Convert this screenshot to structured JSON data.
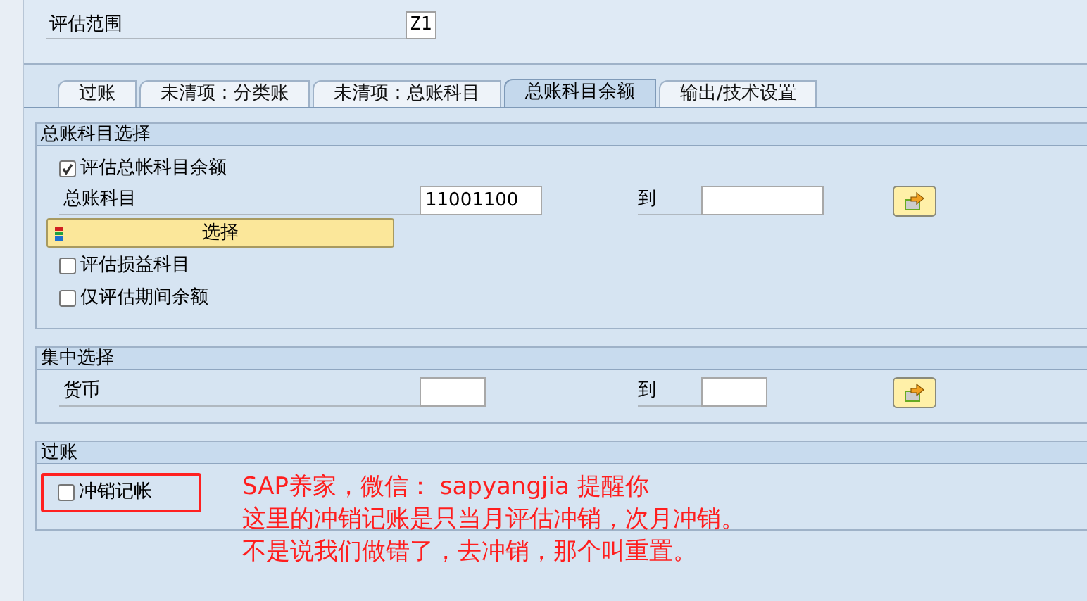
{
  "header": {
    "fields": [
      {
        "label": "评估范围",
        "value": "Z1"
      }
    ]
  },
  "tabs": [
    {
      "label": "过账",
      "selected": false
    },
    {
      "label": "未清项：分类账",
      "selected": false
    },
    {
      "label": "未清项：总账科目",
      "selected": false
    },
    {
      "label": "总账科目余额",
      "selected": true
    },
    {
      "label": "输出/技术设置",
      "selected": false
    }
  ],
  "sections": [
    {
      "title": "总账科目选择",
      "rows": [
        {
          "kind": "checkbox",
          "label": "评估总帐科目余额",
          "checked": true
        },
        {
          "kind": "range",
          "label": "总账科目",
          "from": "11001100",
          "to_label": "到"
        },
        {
          "kind": "button",
          "label": "选择"
        },
        {
          "kind": "checkbox",
          "label": "评估损益科目",
          "checked": false
        },
        {
          "kind": "checkbox",
          "label": "仅评估期间余额",
          "checked": false
        }
      ]
    },
    {
      "title": "集中选择",
      "rows": [
        {
          "kind": "range",
          "label": "货币",
          "to_label": "到",
          "short": true
        }
      ]
    },
    {
      "title": "过账",
      "rows": [
        {
          "kind": "checkbox",
          "label": "冲销记帐",
          "checked": false,
          "highlighted": true
        }
      ]
    }
  ],
  "annotation": {
    "lines": [
      "SAP养家，微信： sapyangjia 提醒你",
      "这里的冲销记账是只当月评估冲销，次月冲销。",
      "不是说我们做错了，去冲销，那个叫重置。"
    ]
  }
}
